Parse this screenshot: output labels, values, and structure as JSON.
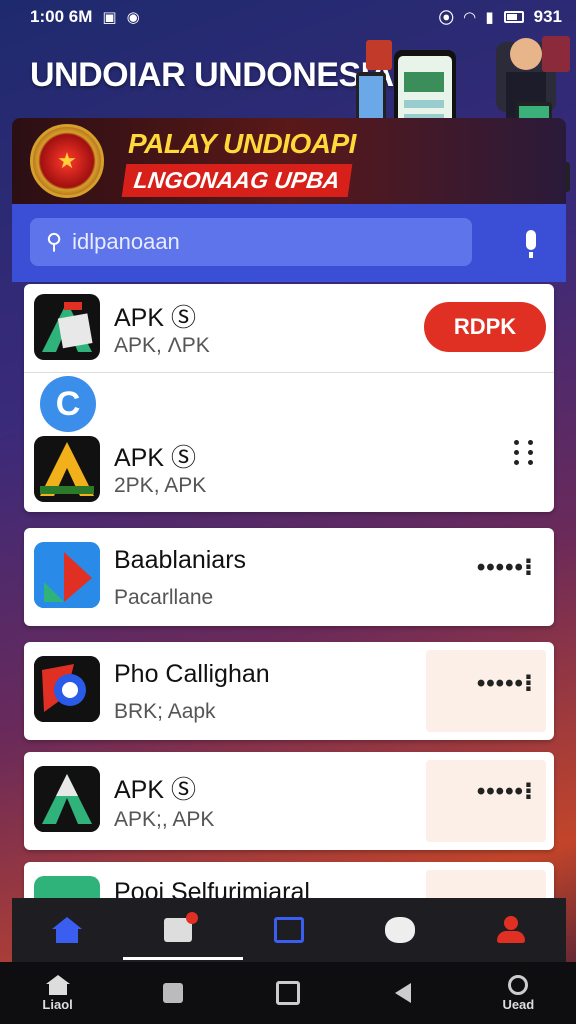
{
  "status_bar": {
    "time": "1:00 6M",
    "battery": "931"
  },
  "header": {
    "title": "UNDOIAR UNDONESIA"
  },
  "banner": {
    "line1": "PALAY UNDIOAPI",
    "line2": "LNGONAAG UPBA"
  },
  "search": {
    "placeholder": "idlpanoaan"
  },
  "apps": [
    {
      "name": "APK Ⓢ",
      "sub": "APK, ΛPK",
      "button": "RDPK"
    },
    {
      "name": "APK Ⓢ",
      "sub": "2PK, APK"
    },
    {
      "name": "Baablaniars",
      "sub": "Pacarllane"
    },
    {
      "name": "Pho Callighan",
      "sub": "BRK; Aapk"
    },
    {
      "name": "APK Ⓢ",
      "sub": "APK;, APK"
    },
    {
      "name": "Pooi Selfurimiaral",
      "sub": ""
    }
  ],
  "refresh_glyph": "C",
  "bottom_nav": [
    "home",
    "news",
    "tabs",
    "games",
    "profile"
  ],
  "system_nav": {
    "left_label": "Liaol",
    "right_label": "Uead"
  },
  "colors": {
    "accent_blue": "#3a4fd6",
    "accent_red": "#e03024",
    "banner_yellow": "#ffd83a"
  }
}
